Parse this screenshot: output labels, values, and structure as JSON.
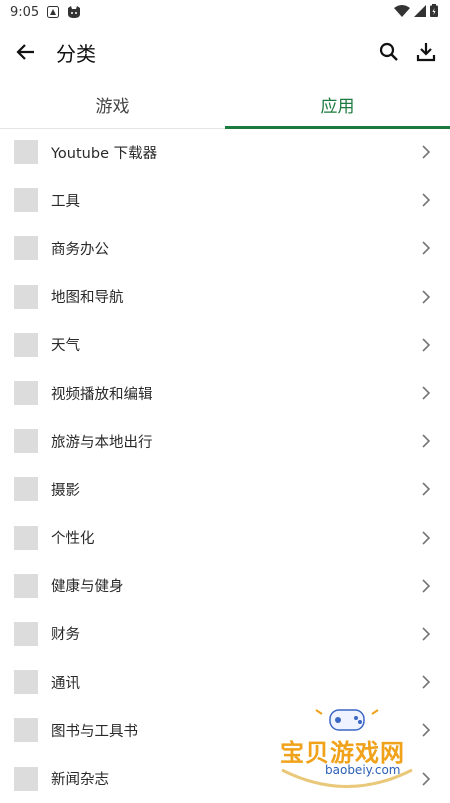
{
  "status": {
    "time": "9:05"
  },
  "appbar": {
    "title": "分类"
  },
  "tabs": [
    {
      "label": "游戏",
      "active": false
    },
    {
      "label": "应用",
      "active": true
    }
  ],
  "categories": [
    {
      "label": "Youtube 下载器"
    },
    {
      "label": "工具"
    },
    {
      "label": "商务办公"
    },
    {
      "label": "地图和导航"
    },
    {
      "label": "天气"
    },
    {
      "label": "视频播放和编辑"
    },
    {
      "label": "旅游与本地出行"
    },
    {
      "label": "摄影"
    },
    {
      "label": "个性化"
    },
    {
      "label": "健康与健身"
    },
    {
      "label": "财务"
    },
    {
      "label": "通讯"
    },
    {
      "label": "图书与工具书"
    },
    {
      "label": "新闻杂志"
    }
  ],
  "watermark": {
    "name": "宝贝游戏网",
    "url": "baobeiy.com"
  },
  "colors": {
    "accent": "#1b7a3d",
    "thumb": "#dcdcdc"
  }
}
